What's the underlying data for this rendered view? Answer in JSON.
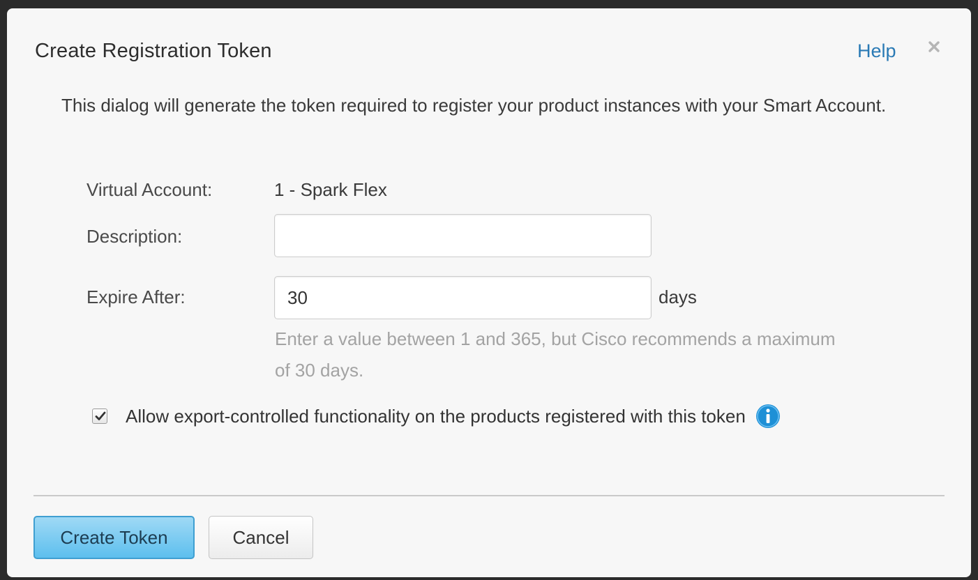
{
  "dialog": {
    "title": "Create Registration Token",
    "help_label": "Help",
    "intro_text": "This dialog will generate the token required to register your product instances with your Smart Account."
  },
  "form": {
    "virtual_account": {
      "label": "Virtual Account:",
      "value": "1 - Spark Flex"
    },
    "description": {
      "label": "Description:",
      "value": "",
      "placeholder": ""
    },
    "expire_after": {
      "label": "Expire After:",
      "value": "30",
      "unit": "days",
      "hint": "Enter a value between 1 and 365, but Cisco recommends a maximum of 30 days."
    },
    "export_controlled": {
      "label": "Allow export-controlled functionality on the products registered with this token",
      "checked": true
    }
  },
  "footer": {
    "create_label": "Create Token",
    "cancel_label": "Cancel"
  },
  "icons": {
    "close": "close-icon",
    "info": "info-icon",
    "check": "checkmark-icon"
  },
  "colors": {
    "link": "#2a7ab5",
    "primary_button": "#5dbfee",
    "info_icon": "#1e90d6",
    "hint_text": "#a3a3a3"
  }
}
